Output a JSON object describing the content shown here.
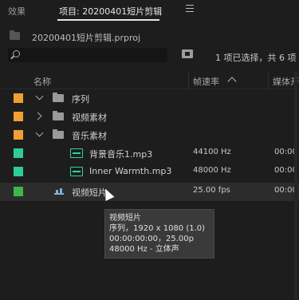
{
  "tabs": {
    "effects": "效果",
    "project": "项目: 20200401短片剪辑"
  },
  "project_file": "20200401短片剪辑.prproj",
  "search": {
    "placeholder": ""
  },
  "selection_info": "1 项已选择，共 6 项",
  "columns": {
    "name": "名称",
    "framerate": "帧速率",
    "media_start": "媒体开"
  },
  "rows": [
    {
      "name": "序列",
      "type": "folder",
      "color": "#f0a030",
      "fps": "",
      "media": ""
    },
    {
      "name": "视频素材",
      "type": "folder",
      "color": "#f0a030",
      "fps": "",
      "media": ""
    },
    {
      "name": "音乐素材",
      "type": "folder",
      "color": "#f0a030",
      "fps": "",
      "media": ""
    },
    {
      "name": "背景音乐1.mp3",
      "type": "audio",
      "color": "#2ecc9a",
      "fps": "44100 Hz",
      "media": "00:00"
    },
    {
      "name": "Inner Warmth.mp3",
      "type": "audio",
      "color": "#2ecc9a",
      "fps": "48000 Hz",
      "media": "00:00"
    },
    {
      "name": "视频短片",
      "type": "sequence",
      "color": "#3cb84a",
      "fps": "25.00 fps",
      "media": "00:00"
    }
  ],
  "tooltip": {
    "line1": "视频短片",
    "line2": "序列，1920 x 1080 (1.0)",
    "line3": "00:00:00:00，25.00p",
    "line4": "48000 Hz - 立体声"
  },
  "colors": {
    "background": "#1d1d1d",
    "folder_label": "#f0a030",
    "audio_label": "#2ecc9a",
    "sequence_label": "#3cb84a"
  }
}
